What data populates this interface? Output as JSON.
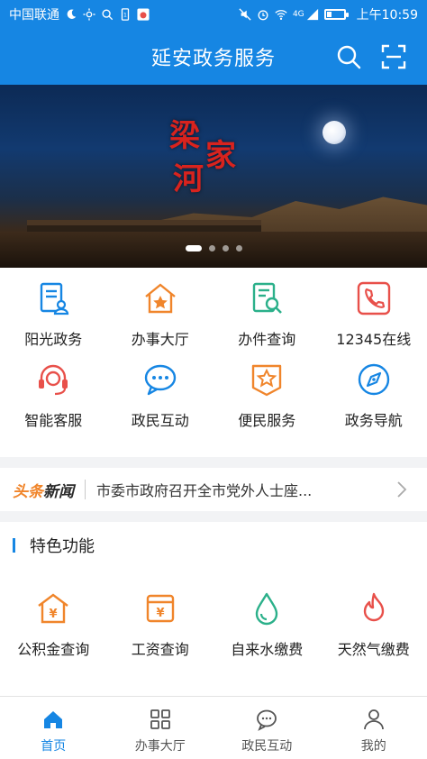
{
  "status_bar": {
    "carrier": "中国联通",
    "network": "4G",
    "time": "上午10:59",
    "battery_level": 0.25,
    "icons": [
      "moon-icon",
      "brightness-icon",
      "search-icon",
      "sim-icon",
      "weibo-icon",
      "mute-icon",
      "alarm-icon",
      "wifi-icon",
      "signal-icon",
      "battery-icon"
    ]
  },
  "app_bar": {
    "title": "延安政务服务",
    "actions": [
      "search-icon",
      "scan-icon"
    ]
  },
  "banner": {
    "calligraphy": [
      "梁",
      "家",
      "河"
    ],
    "slide_count": 4,
    "active_slide": 1
  },
  "services": [
    {
      "label": "阳光政务",
      "icon": "document-person-icon",
      "color": "#1686e3"
    },
    {
      "label": "办事大厅",
      "icon": "house-star-icon",
      "color": "#f0852b"
    },
    {
      "label": "办件查询",
      "icon": "document-search-icon",
      "color": "#2bb08a"
    },
    {
      "label": "12345在线",
      "icon": "phone-icon",
      "color": "#e8504a"
    },
    {
      "label": "智能客服",
      "icon": "headset-icon",
      "color": "#e8504a"
    },
    {
      "label": "政民互动",
      "icon": "chat-icon",
      "color": "#1686e3"
    },
    {
      "label": "便民服务",
      "icon": "star-badge-icon",
      "color": "#f0852b"
    },
    {
      "label": "政务导航",
      "icon": "compass-icon",
      "color": "#1686e3"
    }
  ],
  "news": {
    "tag_part1": "头条",
    "tag_part2": "新闻",
    "headline": "市委市政府召开全市党外人士座..."
  },
  "featured": {
    "title": "特色功能",
    "items": [
      {
        "label": "公积金查询",
        "icon": "house-yen-icon",
        "color": "#f0852b"
      },
      {
        "label": "工资查询",
        "icon": "wallet-yen-icon",
        "color": "#f0852b"
      },
      {
        "label": "自来水缴费",
        "icon": "water-drop-icon",
        "color": "#2bb08a"
      },
      {
        "label": "天然气缴费",
        "icon": "flame-icon",
        "color": "#e8504a"
      }
    ]
  },
  "tab_bar": {
    "tabs": [
      {
        "label": "首页",
        "icon": "home-icon",
        "active": true
      },
      {
        "label": "办事大厅",
        "icon": "grid-icon",
        "active": false
      },
      {
        "label": "政民互动",
        "icon": "chat-icon",
        "active": false
      },
      {
        "label": "我的",
        "icon": "user-icon",
        "active": false
      }
    ],
    "active_color": "#1686e3"
  }
}
